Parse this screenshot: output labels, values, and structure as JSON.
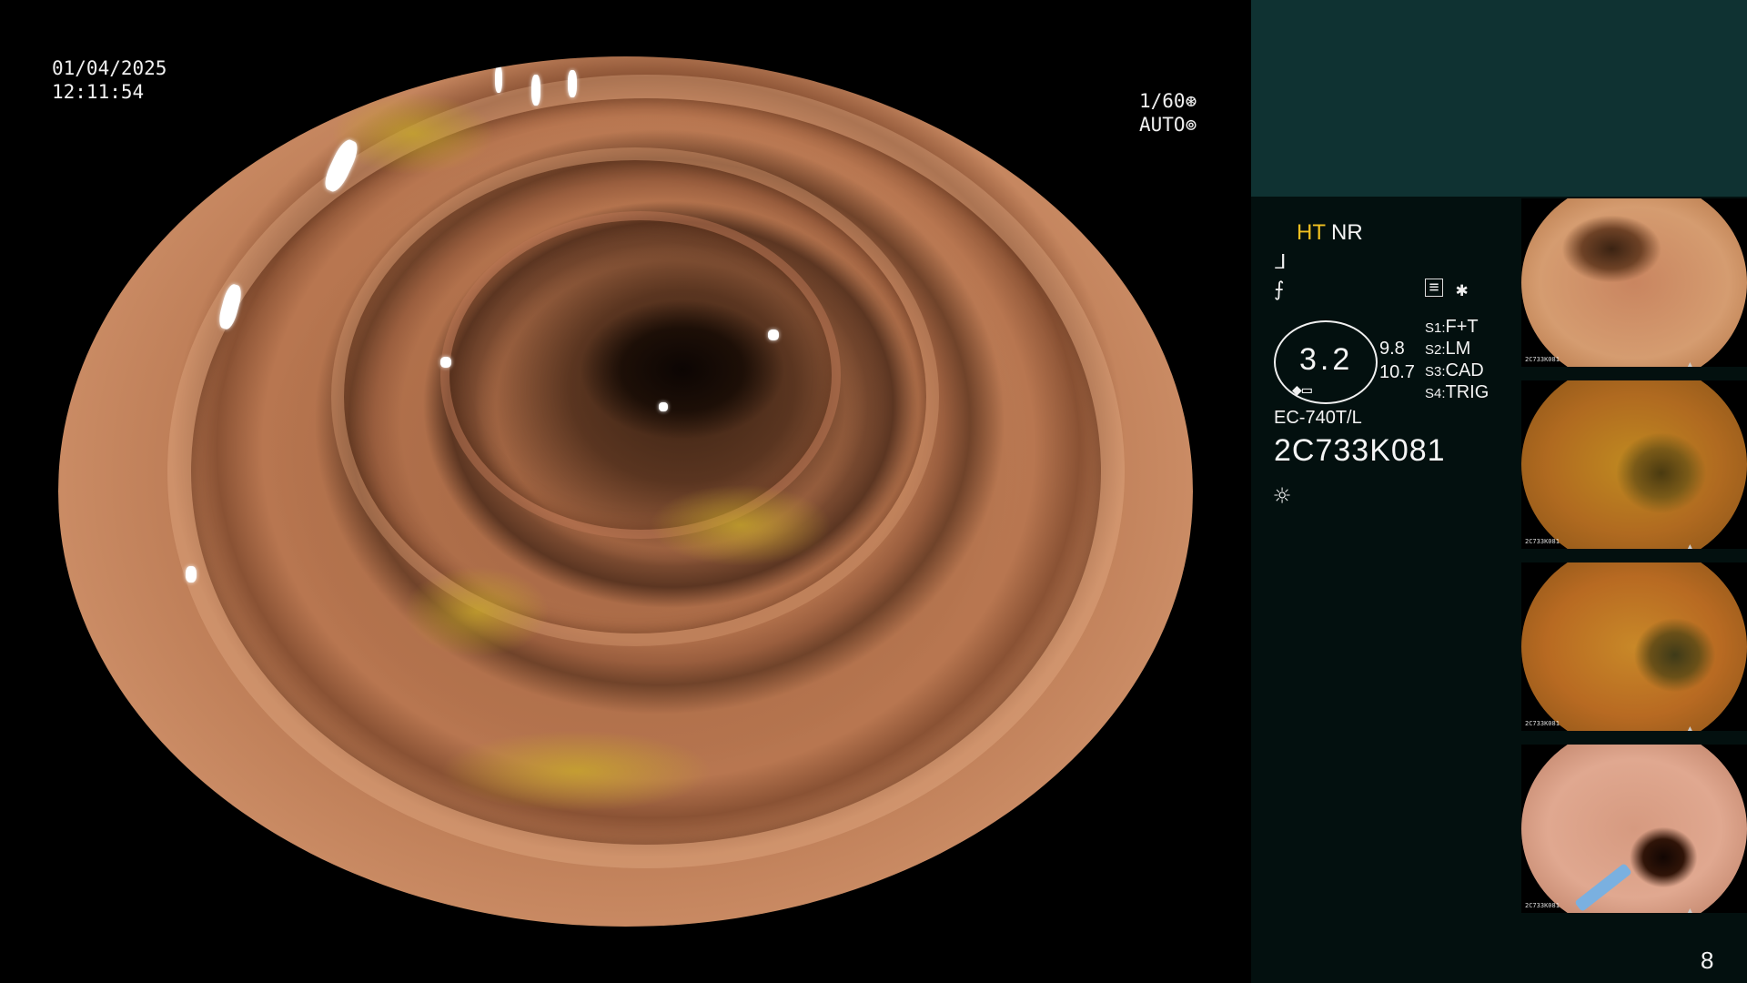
{
  "overlay": {
    "date": "01/04/2025",
    "time": "12:11:54",
    "shutter": "1/60",
    "shutter_icon": "aperture-icon",
    "exposure_mode": "AUTO",
    "exposure_icon": "iris-icon"
  },
  "panel": {
    "mode_ht": "HT",
    "mode_nr": "NR",
    "symbol_1": "ᒧ",
    "symbol_2": "⨍",
    "symbol_star": "✱",
    "zoom": "3.2",
    "zoom_side_a": "9.8",
    "zoom_side_b": "10.7",
    "scope_model": "EC-740T/L",
    "serial": "2C733K081",
    "light_icon": "brightness-icon",
    "slots": [
      {
        "key": "S1:",
        "value": "F+T"
      },
      {
        "key": "S2:",
        "value": "LM"
      },
      {
        "key": "S3:",
        "value": "CAD"
      },
      {
        "key": "S4:",
        "value": "TRIG"
      }
    ],
    "page_number": "8"
  },
  "thumbnails": [
    {
      "label": "2C733K081"
    },
    {
      "label": "2C733K081"
    },
    {
      "label": "2C733K081"
    },
    {
      "label": "2C733K081"
    }
  ],
  "colors": {
    "panel_header": "#0f3232",
    "panel_body": "#03100f",
    "accent_ht": "#f0c020"
  }
}
